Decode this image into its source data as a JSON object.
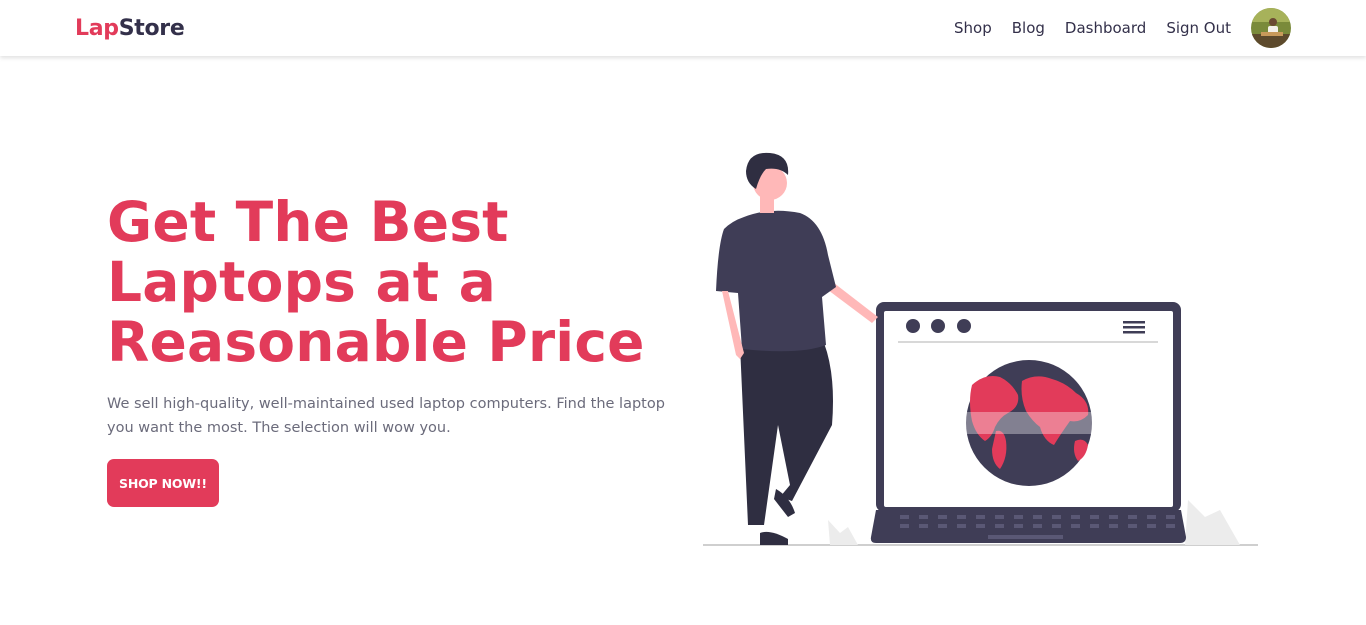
{
  "brand": {
    "part1": "Lap",
    "part2": "Store"
  },
  "nav": {
    "items": [
      {
        "label": "Shop"
      },
      {
        "label": "Blog"
      },
      {
        "label": "Dashboard"
      },
      {
        "label": "Sign Out"
      }
    ]
  },
  "hero": {
    "title_lines": [
      "Get The Best",
      "Laptops at a",
      "Reasonable Price"
    ],
    "description": "We sell high-quality, well-maintained used laptop computers. Find the laptop you want the most. The selection will wow you.",
    "button_label": "SHOP NOW!!"
  },
  "colors": {
    "accent": "#e23b5a",
    "dark": "#3f3d56",
    "text_muted": "#6b6b7b"
  }
}
